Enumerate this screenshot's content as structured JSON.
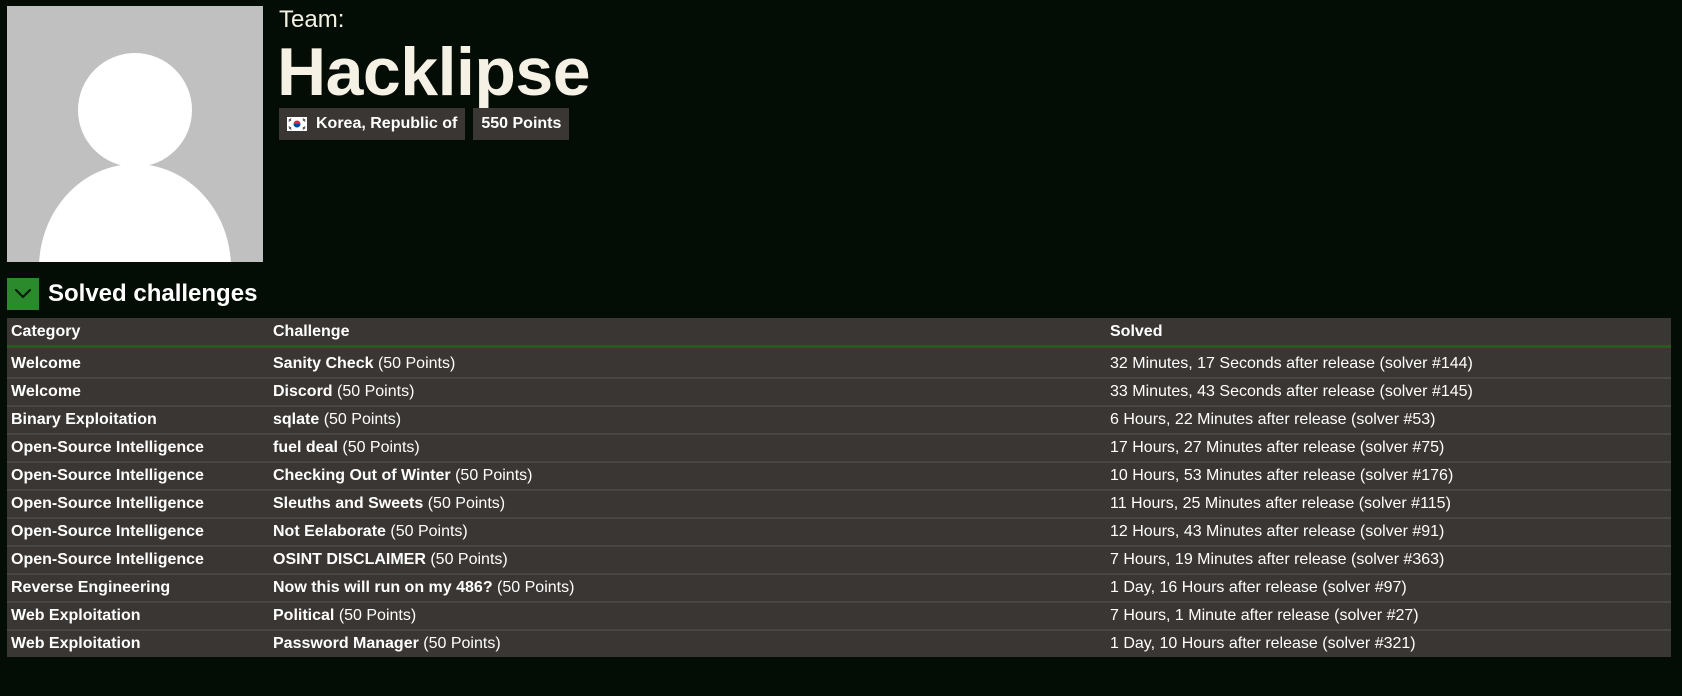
{
  "team": {
    "label": "Team:",
    "name": "Hacklipse",
    "country": "Korea, Republic of",
    "country_flag_icon": "south-korea-flag-icon",
    "points": "550 Points"
  },
  "colors": {
    "background": "#040d05",
    "panel": "#3a3633",
    "accent_green": "#2b8a2b",
    "title_text": "#f5f1e4"
  },
  "solved": {
    "title": "Solved challenges",
    "toggle_icon": "chevron-down-icon",
    "columns": [
      "Category",
      "Challenge",
      "Solved"
    ],
    "rows": [
      {
        "category": "Welcome",
        "challenge": "Sanity Check",
        "points": "(50 Points)",
        "solved": "32 Minutes, 17 Seconds after release (solver #144)"
      },
      {
        "category": "Welcome",
        "challenge": "Discord",
        "points": "(50 Points)",
        "solved": "33 Minutes, 43 Seconds after release (solver #145)"
      },
      {
        "category": "Binary Exploitation",
        "challenge": "sqlate",
        "points": "(50 Points)",
        "solved": "6 Hours, 22 Minutes after release (solver #53)"
      },
      {
        "category": "Open-Source Intelligence",
        "challenge": "fuel deal",
        "points": "(50 Points)",
        "solved": "17 Hours, 27 Minutes after release (solver #75)"
      },
      {
        "category": "Open-Source Intelligence",
        "challenge": "Checking Out of Winter",
        "points": "(50 Points)",
        "solved": "10 Hours, 53 Minutes after release (solver #176)"
      },
      {
        "category": "Open-Source Intelligence",
        "challenge": "Sleuths and Sweets",
        "points": "(50 Points)",
        "solved": "11 Hours, 25 Minutes after release (solver #115)"
      },
      {
        "category": "Open-Source Intelligence",
        "challenge": "Not Eelaborate",
        "points": "(50 Points)",
        "solved": "12 Hours, 43 Minutes after release (solver #91)"
      },
      {
        "category": "Open-Source Intelligence",
        "challenge": "OSINT DISCLAIMER",
        "points": "(50 Points)",
        "solved": "7 Hours, 19 Minutes after release (solver #363)"
      },
      {
        "category": "Reverse Engineering",
        "challenge": "Now this will run on my 486?",
        "points": "(50 Points)",
        "solved": "1 Day, 16 Hours after release (solver #97)"
      },
      {
        "category": "Web Exploitation",
        "challenge": "Political",
        "points": "(50 Points)",
        "solved": "7 Hours, 1 Minute after release (solver #27)"
      },
      {
        "category": "Web Exploitation",
        "challenge": "Password Manager",
        "points": "(50 Points)",
        "solved": "1 Day, 10 Hours after release (solver #321)"
      }
    ]
  }
}
